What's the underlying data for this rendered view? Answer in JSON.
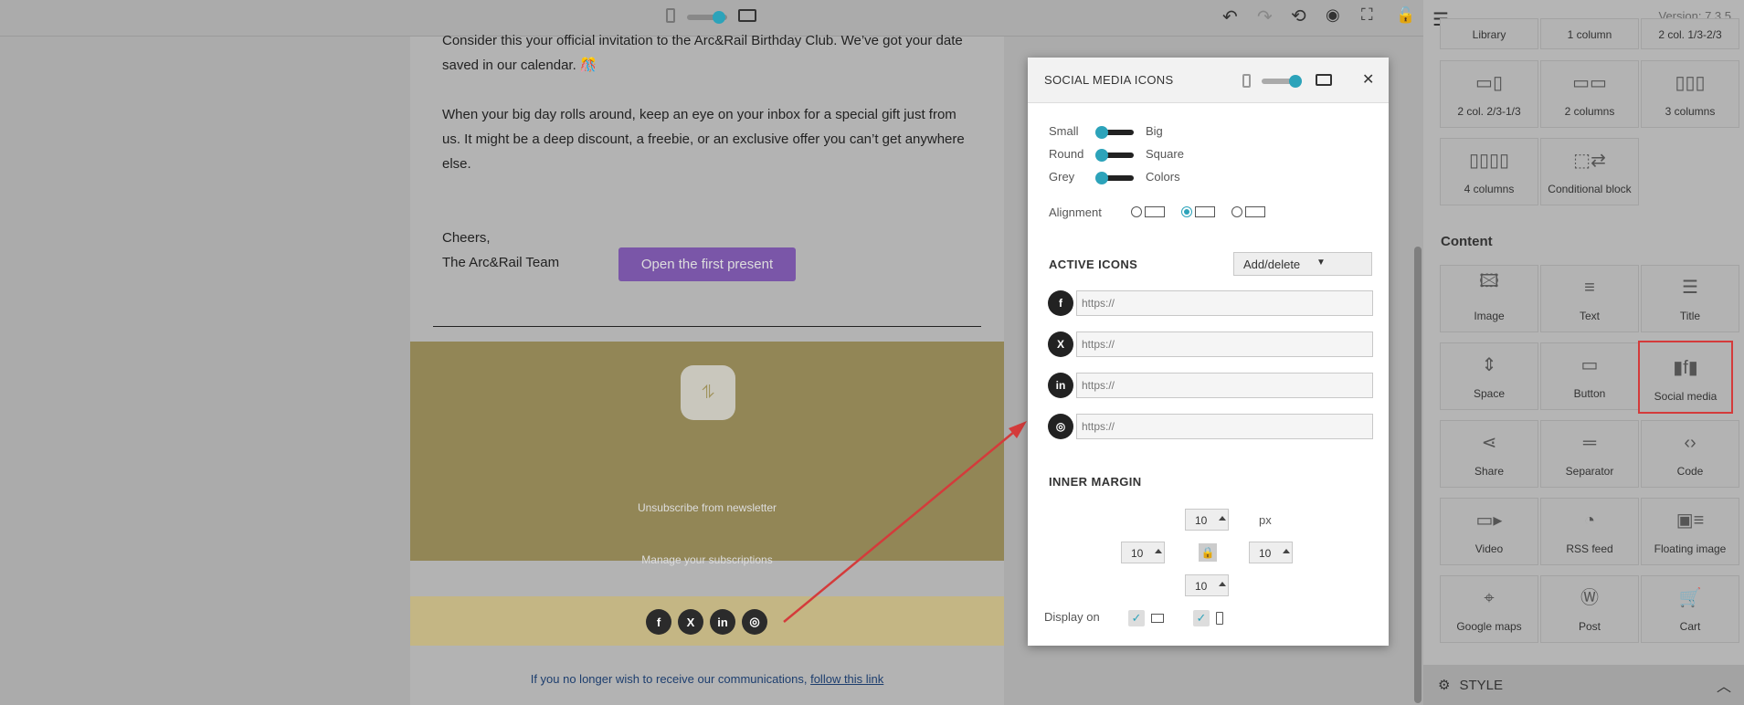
{
  "topbar": {
    "version": "Version: 7.3.5"
  },
  "email": {
    "para1_line1": "Consider this your official invitation to the Arc&Rail Birthday Club. We’ve got your date",
    "para1_line2": "saved in our calendar. 🎊",
    "para2_line1": "When your big day rolls around, keep an eye on your inbox for a special gift just from",
    "para2_line2": "us. It might be a deep discount, a freebie, or an exclusive offer you can’t get anywhere",
    "para2_line3": "else.",
    "signoff": "Cheers,",
    "signature": "The Arc&Rail Team",
    "cta_label": "Open the first present",
    "unsubscribe_link": "Unsubscribe from newsletter",
    "manage_link": "Manage your subscriptions",
    "optout_text": "If you no longer wish to receive our communications,",
    "optout_link": "follow this link"
  },
  "modal": {
    "title": "SOCIAL MEDIA ICONS",
    "size_min": "Small",
    "size_max": "Big",
    "shape_min": "Round",
    "shape_max": "Square",
    "color_min": "Grey",
    "color_max": "Colors",
    "alignment_label": "Alignment",
    "active_icons_title": "ACTIVE ICONS",
    "add_delete_label": "Add/delete",
    "url_placeholder": "https://",
    "inner_margin_title": "INNER MARGIN",
    "margin_top": "10",
    "margin_left": "10",
    "margin_right": "10",
    "margin_bottom": "10",
    "margin_unit": "px",
    "display_on_label": "Display on"
  },
  "sidebar": {
    "layout_tiles": [
      "Library",
      "1 column",
      "2 col. 1/3-2/3",
      "2 col. 2/3-1/3",
      "2 columns",
      "3 columns",
      "4 columns",
      "Conditional block"
    ],
    "content_title": "Content",
    "content_tiles": [
      "Image",
      "Text",
      "Title",
      "Space",
      "Button",
      "Social media",
      "Share",
      "Separator",
      "Code",
      "Video",
      "RSS feed",
      "Floating image",
      "Google maps",
      "Post",
      "Cart"
    ],
    "style_label": "STYLE"
  },
  "colors": {
    "accent": "#2ca3ba",
    "cta": "#7a56a8",
    "highlight": "#d43b3b"
  }
}
